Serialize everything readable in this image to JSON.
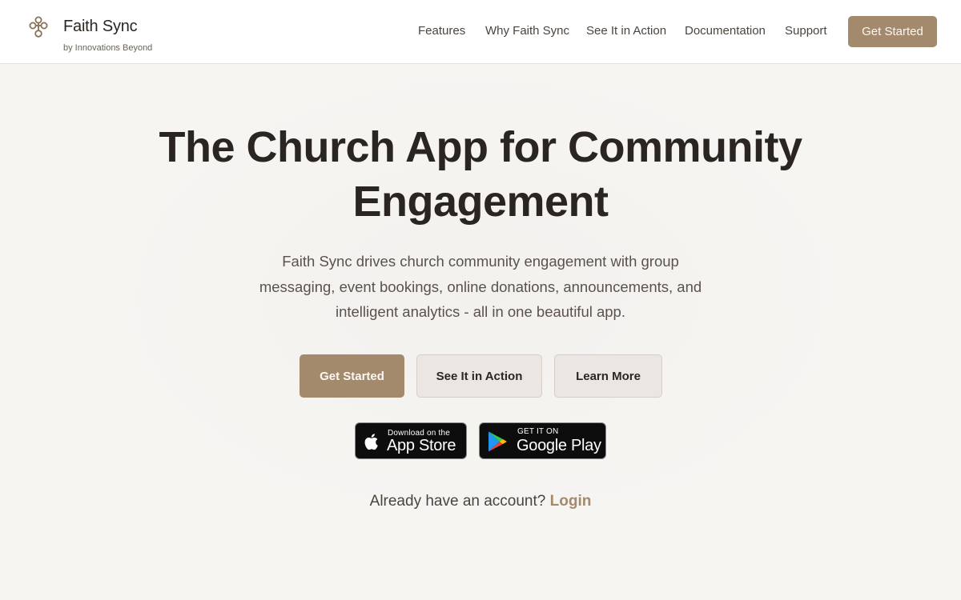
{
  "header": {
    "brand_name": "Faith Sync",
    "brand_subtitle": "by Innovations Beyond",
    "nav": [
      "Features",
      "Why Faith Sync",
      "See It in Action",
      "Documentation",
      "Support"
    ],
    "cta_label": "Get Started"
  },
  "hero": {
    "title_line1": "The Church App for Community",
    "title_line2": "Engagement",
    "desc_line1": "Faith Sync drives church community engagement with group",
    "desc_line2": "messaging, event bookings, online donations, announcements, and",
    "desc_line3": "intelligent analytics - all in one beautiful app.",
    "buttons": {
      "primary": "Get Started",
      "secondary": "See It in Action",
      "tertiary": "Learn More"
    }
  },
  "stores": {
    "apple_small": "Download on the",
    "apple_big": "App Store",
    "google_small": "GET IT ON",
    "google_big": "Google Play"
  },
  "login": {
    "prompt": "Already have an account?",
    "link": "Login"
  },
  "colors": {
    "accent": "#a38a6d",
    "background": "#f7f5f2",
    "text": "#2b2622"
  },
  "icons": [
    "cross-logo-icon",
    "apple-icon",
    "google-play-icon"
  ]
}
